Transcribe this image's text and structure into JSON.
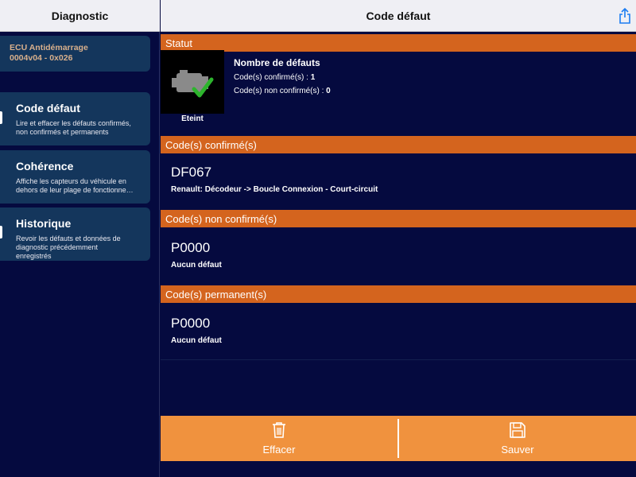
{
  "left_header": {
    "title": "Diagnostic"
  },
  "right_header": {
    "title": "Code défaut"
  },
  "ecu": {
    "name": "ECU Antidémarrage",
    "id": "0004v04 - 0x026"
  },
  "menu": [
    {
      "title": "Code défaut",
      "desc": "Lire et effacer les défauts confirmés, non confirmés et permanents"
    },
    {
      "title": "Cohérence",
      "desc": "Affiche les capteurs du véhicule en dehors de leur plage de fonctionne…"
    },
    {
      "title": "Historique",
      "desc": "Revoir les défauts et données de diagnostic précédemment enregistrés"
    }
  ],
  "statut": {
    "header": "Statut",
    "engine_label": "Eteint",
    "title": "Nombre de défauts",
    "confirmed_label": "Code(s) confirmé(s) : ",
    "confirmed_count": "1",
    "unconfirmed_label": "Code(s) non confirmé(s) : ",
    "unconfirmed_count": "0"
  },
  "sections": [
    {
      "header": "Code(s) confirmé(s)",
      "code": "DF067",
      "desc": "Renault: Décodeur -> Boucle Connexion - Court-circuit"
    },
    {
      "header": "Code(s) non confirmé(s)",
      "code": "P0000",
      "desc": "Aucun défaut"
    },
    {
      "header": "Code(s) permanent(s)",
      "code": "P0000",
      "desc": "Aucun défaut"
    }
  ],
  "actions": {
    "clear_label": "Effacer",
    "save_label": "Sauver"
  },
  "colors": {
    "orange": "#d4641e",
    "action_orange": "#f0923e",
    "navy": "#050a3f",
    "card": "#14365c"
  }
}
